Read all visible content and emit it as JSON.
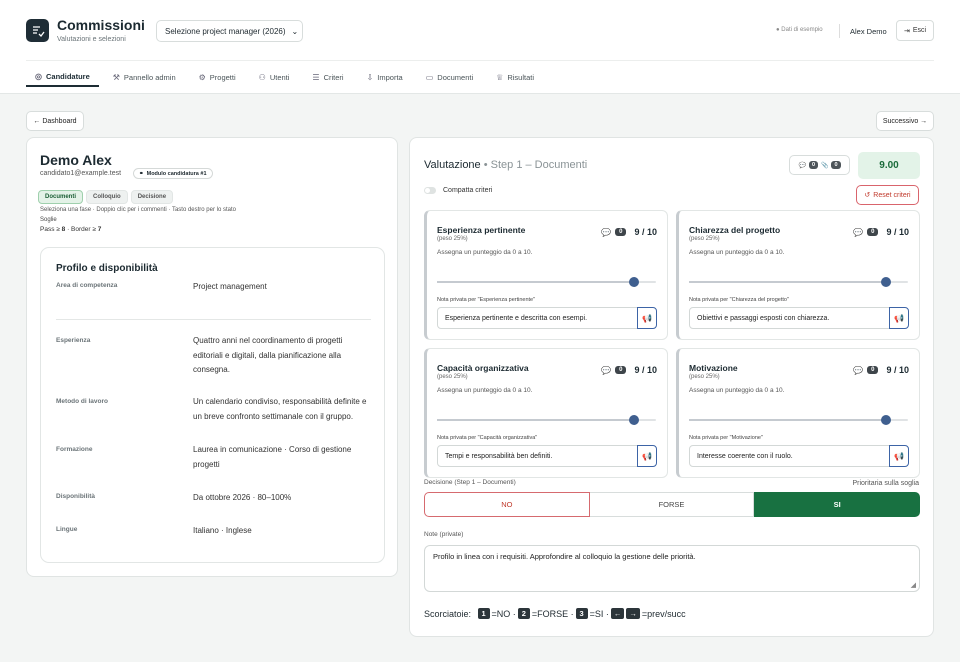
{
  "header": {
    "title": "Commissioni",
    "subtitle": "Valutazioni e selezioni",
    "pm_select": "Selezione project manager (2026)",
    "demo_data": "● Dati di esempio",
    "user": "Alex Demo",
    "logout": "Esci"
  },
  "nav": [
    {
      "label": "Candidature",
      "icon": "◎"
    },
    {
      "label": "Pannello admin",
      "icon": "⚒"
    },
    {
      "label": "Progetti",
      "icon": "⚙"
    },
    {
      "label": "Utenti",
      "icon": "⚇"
    },
    {
      "label": "Criteri",
      "icon": "☰"
    },
    {
      "label": "Importa",
      "icon": "⇩"
    },
    {
      "label": "Documenti",
      "icon": "▭"
    },
    {
      "label": "Risultati",
      "icon": "♕"
    }
  ],
  "buttons": {
    "dashboard": "← Dashboard",
    "next": "Successivo →"
  },
  "candidate": {
    "name": "Demo Alex",
    "email": "candidato1@example.test",
    "module": "Modulo candidatura #1",
    "phases": [
      "Documenti",
      "Colloquio",
      "Decisione"
    ],
    "phase_hint": "Seleziona una fase · Doppio clic per i commenti · Tasto destro per lo stato",
    "thresholds_label": "Soglie",
    "pass_label": "Pass ≥",
    "pass_value": "8",
    "border_label": "· Border ≥",
    "border_value": "7"
  },
  "profile": {
    "title": "Profilo e disponibilità",
    "rows": [
      {
        "label": "Area di competenza",
        "value": "Project management"
      },
      {
        "label": "Esperienza",
        "value": "Quattro anni nel coordinamento di progetti editoriali e digitali, dalla pianificazione alla consegna."
      },
      {
        "label": "Metodo di lavoro",
        "value": "Un calendario condiviso, responsabilità definite e un breve confronto settimanale con il gruppo."
      },
      {
        "label": "Formazione",
        "value": "Laurea in comunicazione · Corso di gestione progetti"
      },
      {
        "label": "Disponibilità",
        "value": "Da ottobre 2026 · 80–100%"
      },
      {
        "label": "Lingue",
        "value": "Italiano · Inglese"
      }
    ]
  },
  "evaluation": {
    "title": "Valutazione",
    "step": "• Step 1 – Documenti",
    "comments_count": "0",
    "attachments_count": "0",
    "total_score": "9.00",
    "compact_label": "Compatta criteri",
    "reset_label": "Reset criteri",
    "criteria": [
      {
        "name": "Esperienza pertinente",
        "weight": "(peso 25%)",
        "assign": "Assegna un punteggio da 0 a 10.",
        "comments": "0",
        "score": "9 / 10",
        "value": 9,
        "max": 10,
        "note_label": "Nota privata per \"Esperienza pertinente\"",
        "note": "Esperienza pertinente e descritta con esempi."
      },
      {
        "name": "Chiarezza del progetto",
        "weight": "(peso 25%)",
        "assign": "Assegna un punteggio da 0 a 10.",
        "comments": "0",
        "score": "9 / 10",
        "value": 9,
        "max": 10,
        "note_label": "Nota privata per \"Chiarezza del progetto\"",
        "note": "Obiettivi e passaggi esposti con chiarezza."
      },
      {
        "name": "Capacità organizzativa",
        "weight": "(peso 25%)",
        "assign": "Assegna un punteggio da 0 a 10.",
        "comments": "0",
        "score": "9 / 10",
        "value": 9,
        "max": 10,
        "note_label": "Nota privata per \"Capacità organizzativa\"",
        "note": "Tempi e responsabilità ben definiti."
      },
      {
        "name": "Motivazione",
        "weight": "(peso 25%)",
        "assign": "Assegna un punteggio da 0 a 10.",
        "comments": "0",
        "score": "9 / 10",
        "value": 9,
        "max": 10,
        "note_label": "Nota privata per \"Motivazione\"",
        "note": "Interesse coerente con il ruolo."
      }
    ],
    "decision_label": "Decisione (Step 1 – Documenti)",
    "decision_priority": "Prioritaria sulla soglia",
    "decisions": [
      "NO",
      "FORSE",
      "SI"
    ],
    "selected_decision": "SI",
    "notes_label": "Note (private)",
    "notes_value": "Profilo in linea con i requisiti. Approfondire al colloquio la gestione delle priorità.",
    "shortcuts": {
      "label": "Scorciatoie:",
      "k1": "1",
      "t1": "=NO ·",
      "k2": "2",
      "t2": "=FORSE ·",
      "k3": "3",
      "t3": "=SI ·",
      "kp": "←",
      "kn": "→",
      "tn": "=prev/succ"
    }
  },
  "colors": {
    "accent": "#1d2c34",
    "success": "#187141",
    "danger": "#c0392b",
    "link": "#3368c0"
  }
}
